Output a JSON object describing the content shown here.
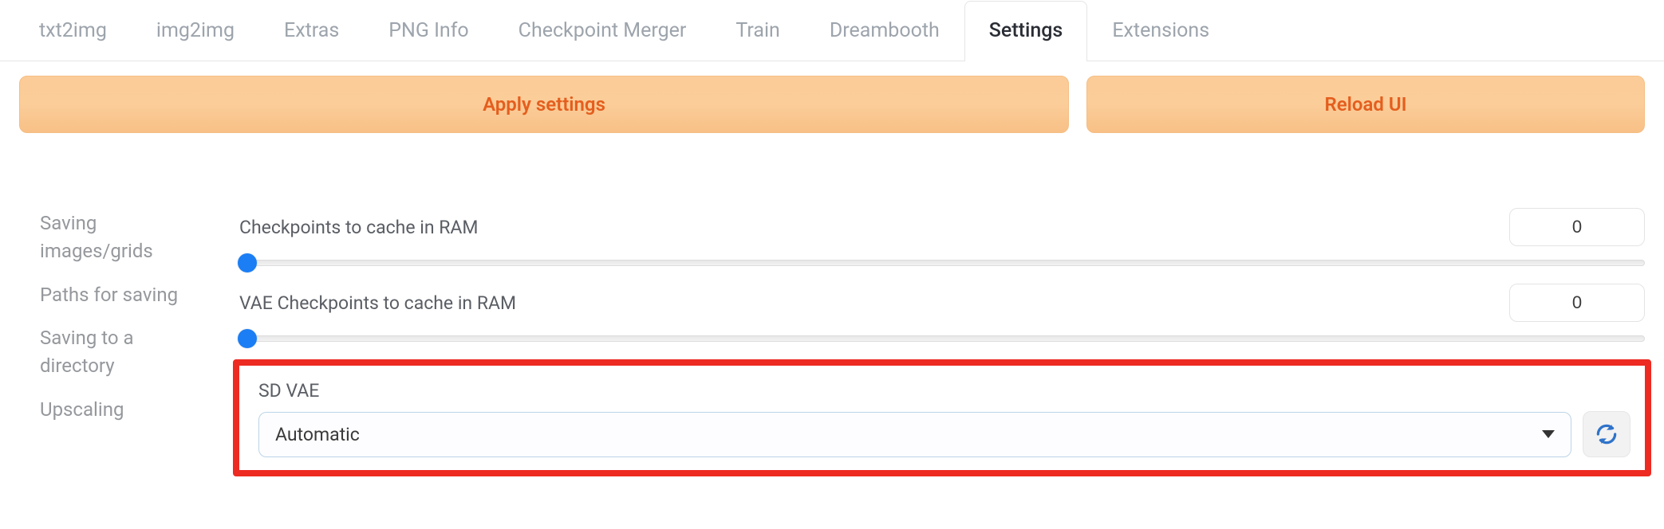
{
  "tabs": [
    {
      "label": "txt2img"
    },
    {
      "label": "img2img"
    },
    {
      "label": "Extras"
    },
    {
      "label": "PNG Info"
    },
    {
      "label": "Checkpoint Merger"
    },
    {
      "label": "Train"
    },
    {
      "label": "Dreambooth"
    },
    {
      "label": "Settings"
    },
    {
      "label": "Extensions"
    }
  ],
  "active_tab_index": 7,
  "buttons": {
    "apply": "Apply settings",
    "reload": "Reload UI"
  },
  "sidebar": {
    "items": [
      {
        "label": "Saving images/grids"
      },
      {
        "label": "Paths for saving"
      },
      {
        "label": "Saving to a directory"
      },
      {
        "label": "Upscaling"
      }
    ]
  },
  "settings": {
    "checkpoints_ram": {
      "label": "Checkpoints to cache in RAM",
      "value": "0"
    },
    "vae_checkpoints_ram": {
      "label": "VAE Checkpoints to cache in RAM",
      "value": "0"
    },
    "sd_vae": {
      "label": "SD VAE",
      "selected": "Automatic"
    }
  },
  "colors": {
    "accent_orange": "#e45e1e",
    "highlight_red": "#ed2b22",
    "slider_thumb": "#1b7ef5"
  }
}
